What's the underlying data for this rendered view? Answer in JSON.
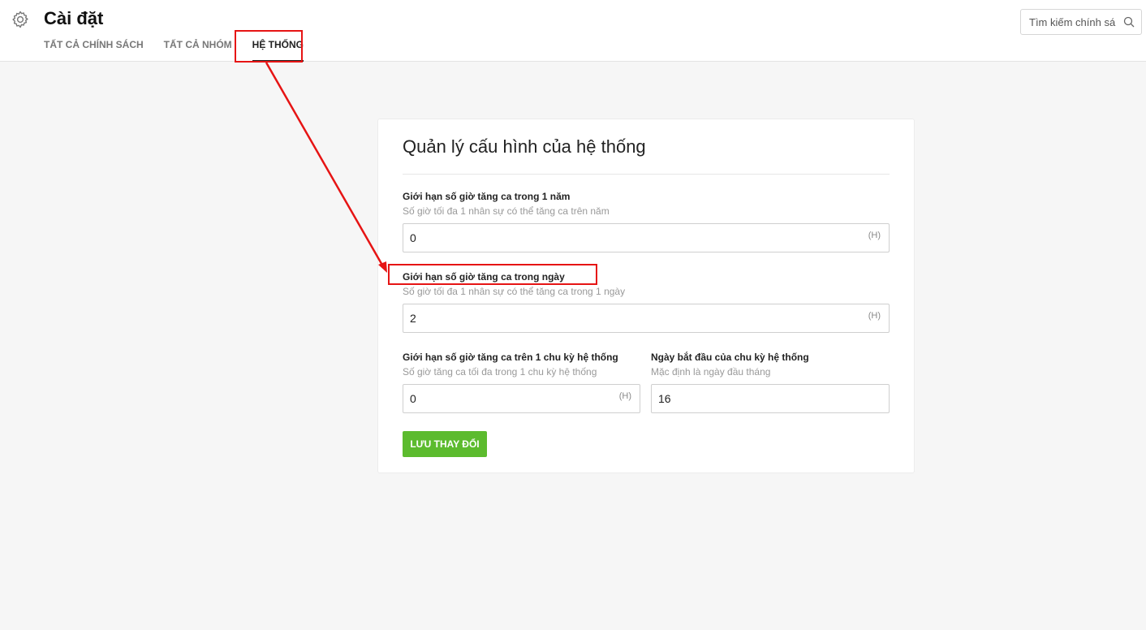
{
  "header": {
    "title": "Cài đặt",
    "tabs": [
      {
        "label": "TẤT CẢ CHÍNH SÁCH",
        "active": false
      },
      {
        "label": "TẤT CẢ NHÓM",
        "active": false
      },
      {
        "label": "HỆ THỐNG",
        "active": true
      }
    ],
    "search": {
      "placeholder": "Tìm kiếm chính sá",
      "value": ""
    }
  },
  "card": {
    "title": "Quản lý cấu hình của hệ thống",
    "fields": [
      {
        "label": "Giới hạn số giờ tăng ca trong 1 năm",
        "help": "Số giờ tối đa 1 nhân sự có thể tăng ca trên năm",
        "value": "0",
        "unit": "(H)"
      },
      {
        "label": "Giới hạn số giờ tăng ca trong ngày",
        "help": "Số giờ tối đa 1 nhân sự có thể tăng ca trong 1 ngày",
        "value": "2",
        "unit": "(H)"
      },
      {
        "label": "Giới hạn số giờ tăng ca trên 1 chu kỳ hệ thống",
        "help": "Số giờ tăng ca tối đa trong 1 chu kỳ hệ thống",
        "value": "0",
        "unit": "(H)"
      },
      {
        "label": "Ngày bắt đầu của chu kỳ hệ thống",
        "help": "Mặc định là ngày đầu tháng",
        "value": "16"
      }
    ],
    "save_label": "LƯU THAY ĐỔI"
  },
  "colors": {
    "accent_green": "#5cbb2e",
    "annotation_red": "#e61414"
  },
  "icons": {
    "settings": "gear-icon",
    "search": "search-icon"
  }
}
